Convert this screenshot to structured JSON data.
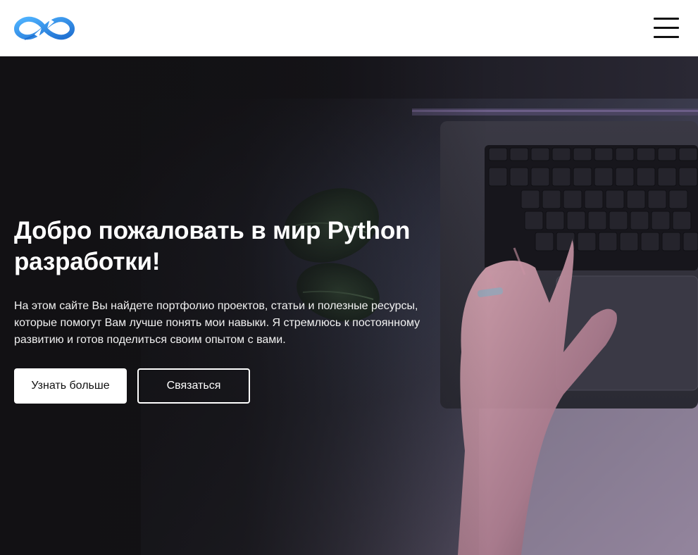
{
  "header": {
    "logo_icon": "infinity-logo",
    "menu_icon": "hamburger-menu-icon"
  },
  "hero": {
    "title": "Добро пожаловать в мир Python разработки!",
    "description": "На этом сайте Вы найдете портфолио проектов, статьи и полезные ресурсы, которые помогут Вам лучше понять мои навыки. Я стремлюсь к постоянному развитию и готов поделиться своим опытом с вами.",
    "primary_button": "Узнать больше",
    "secondary_button": "Связаться",
    "background_image": "laptop-keyboard-hand-photo"
  },
  "colors": {
    "header_bg": "#ffffff",
    "hero_bg": "#141316",
    "logo_blue": "#2f8fe6",
    "text_light": "#ffffff"
  }
}
